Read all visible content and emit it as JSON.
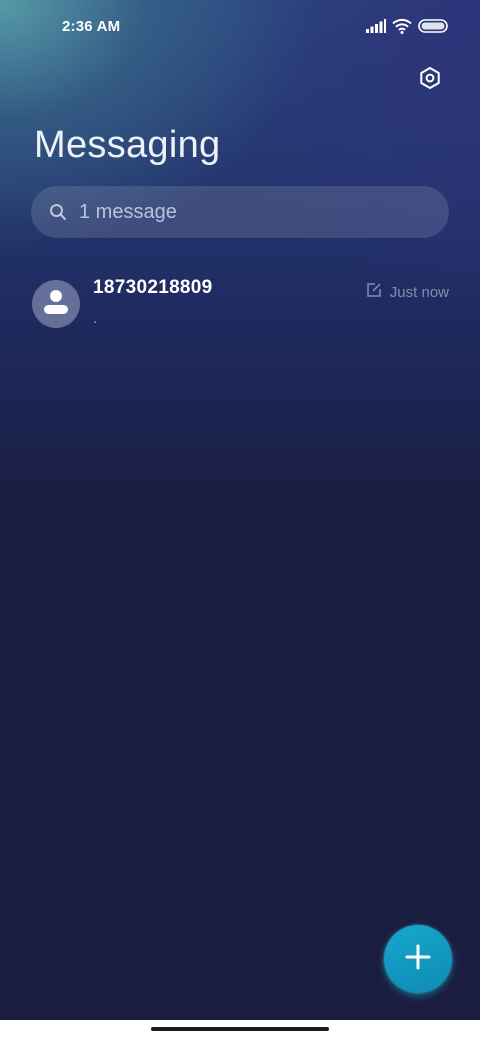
{
  "status_bar": {
    "time": "2:36 AM",
    "icons": [
      "signal-icon",
      "wifi-icon",
      "battery-icon"
    ]
  },
  "header": {
    "title": "Messaging",
    "settings_icon": "settings-icon"
  },
  "search": {
    "placeholder": "1 message",
    "icon": "search-icon"
  },
  "conversations": [
    {
      "sender": "18730218809",
      "preview": ".",
      "timestamp": "Just now",
      "status_icon": "draft-edit-icon",
      "avatar_icon": "person-icon"
    }
  ],
  "fab": {
    "icon": "plus-icon"
  },
  "colors": {
    "accent": "#12A0C8",
    "background_dark": "#1A1D3F",
    "gradient_teal": "#58A0AA"
  }
}
